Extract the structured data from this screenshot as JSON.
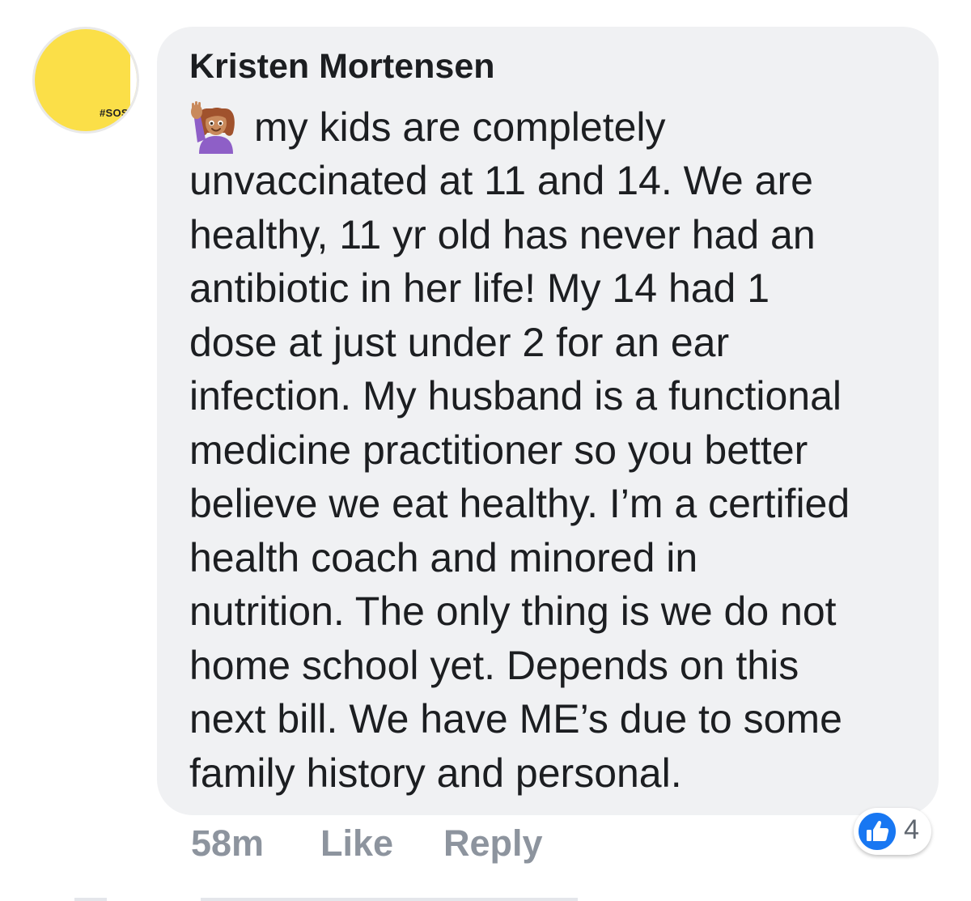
{
  "comment": {
    "avatar": {
      "tag": "#SOS",
      "color": "#fbdf48"
    },
    "author": "Kristen Mortensen",
    "emoji": "woman-raising-hand-icon",
    "lines": [
      "my kids are completely",
      "unvaccinated at 11 and 14. We are",
      "healthy, 11 yr old has never had an",
      "antibiotic in her life! My 14 had 1",
      "dose at just under 2 for an ear",
      "infection. My husband is a functional",
      "medicine practitioner so you better",
      "believe we eat healthy. I’m a certified",
      "health coach and minored in",
      "nutrition. The only thing is we do not",
      "home school yet. Depends on this",
      "next bill. We have ME’s due to some",
      "family history and personal."
    ],
    "timestamp": "58m",
    "like_label": "Like",
    "reply_label": "Reply",
    "reactions": {
      "icon": "thumbs-up-icon",
      "count": "4"
    }
  },
  "colors": {
    "bubble": "#f0f1f3",
    "author_text": "#1c1e21",
    "footer_text": "#8d949e",
    "like_blue": "#1877f2"
  }
}
